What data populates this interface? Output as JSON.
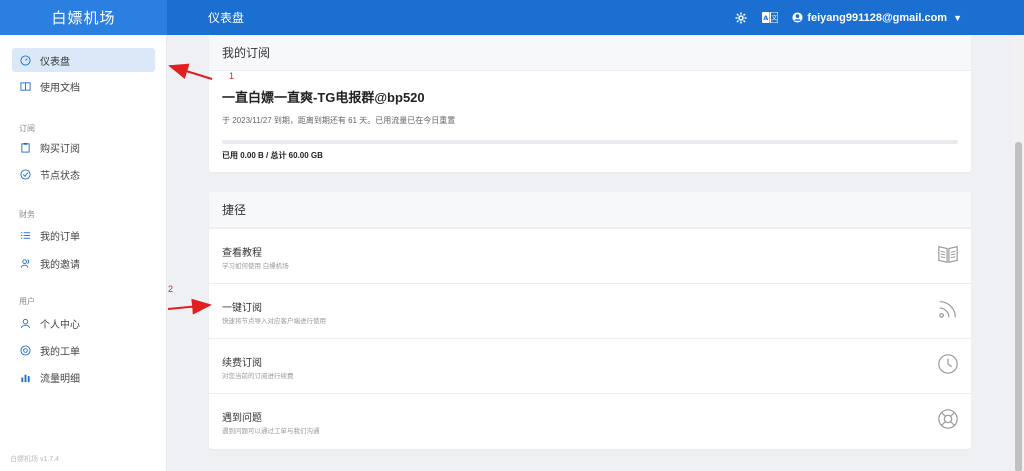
{
  "header": {
    "brand": "白嫖机场",
    "title": "仪表盘",
    "user_email": "feiyang991128@gmail.com",
    "icons": [
      "gear-icon",
      "translate-icon",
      "user-circle-icon",
      "chevron-down-icon"
    ]
  },
  "sidebar": {
    "items": [
      {
        "label": "仪表盘",
        "icon": "dashboard-icon",
        "active": true
      },
      {
        "label": "使用文档",
        "icon": "book-icon"
      }
    ],
    "groups": [
      {
        "label": "订阅",
        "items": [
          {
            "label": "购买订阅",
            "icon": "clipboard-icon"
          },
          {
            "label": "节点状态",
            "icon": "check-circle-icon"
          }
        ]
      },
      {
        "label": "财务",
        "items": [
          {
            "label": "我的订单",
            "icon": "list-icon"
          },
          {
            "label": "我的邀请",
            "icon": "users-icon"
          }
        ]
      },
      {
        "label": "用户",
        "items": [
          {
            "label": "个人中心",
            "icon": "user-icon"
          },
          {
            "label": "我的工单",
            "icon": "support-icon"
          },
          {
            "label": "流量明细",
            "icon": "bar-chart-icon"
          }
        ]
      }
    ],
    "version": "白嫖机场 v1.7.4"
  },
  "subscription": {
    "header": "我的订阅",
    "plan_name": "一直白嫖一直爽-TG电报群@bp520",
    "expiry_text": "于 2023/11/27 到期，距离到期还有 61 天。已用流量已在今日重置",
    "usage_fraction": 0,
    "usage_text": "已用 0.00 B / 总计 60.00 GB"
  },
  "shortcuts": {
    "header": "捷径",
    "items": [
      {
        "title": "查看教程",
        "desc": "学习如何使用 白嫖机场",
        "icon": "open-book-icon"
      },
      {
        "title": "一键订阅",
        "desc": "快速将节点导入对应客户端进行使用",
        "icon": "rss-icon"
      },
      {
        "title": "续费订阅",
        "desc": "对您当前的订阅进行续费",
        "icon": "clock-icon"
      },
      {
        "title": "遇到问题",
        "desc": "遇到问题可以通过工单与我们沟通",
        "icon": "lifebuoy-icon"
      }
    ]
  },
  "annotations": {
    "labels": [
      "1",
      "2"
    ],
    "color": "#e02020"
  },
  "colors": {
    "header": "#1a6fd1",
    "brand_bg": "#2a7fe0",
    "active_nav": "#dbe8f8",
    "background": "#eef0f3"
  }
}
